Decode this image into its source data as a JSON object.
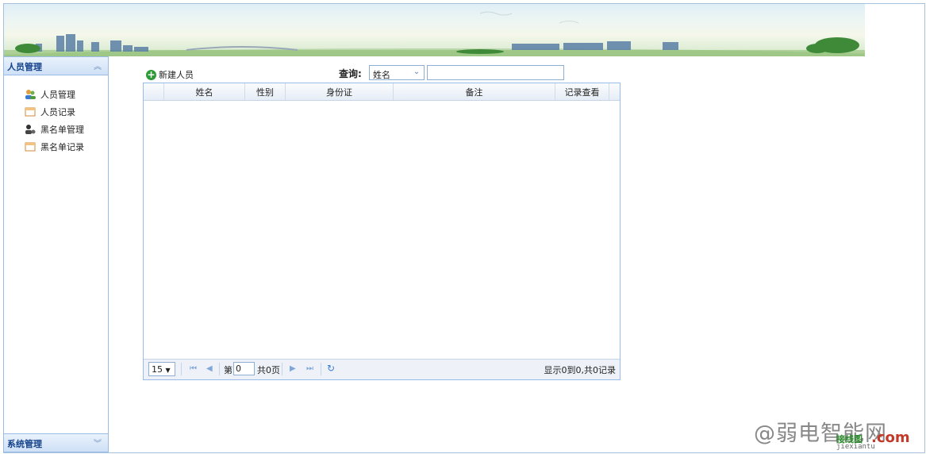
{
  "sidebar": {
    "top_panel_title": "人员管理",
    "items": [
      {
        "label": "人员管理",
        "icon": "users-icon"
      },
      {
        "label": "人员记录",
        "icon": "calendar-icon"
      },
      {
        "label": "黑名单管理",
        "icon": "blacklist-user-icon"
      },
      {
        "label": "黑名单记录",
        "icon": "calendar-icon"
      }
    ],
    "bottom_panel_title": "系统管理"
  },
  "toolbar": {
    "add_label": "新建人员",
    "query_label": "查询:",
    "field_select": "姓名",
    "search_value": ""
  },
  "grid": {
    "columns": [
      "姓名",
      "性别",
      "身份证",
      "备注",
      "记录查看"
    ],
    "rows": []
  },
  "pager": {
    "page_size": "15",
    "page_prefix": "第",
    "page_number": "0",
    "total_pages": "共0页",
    "summary": "显示0到0,共0记录"
  },
  "watermark": {
    "text": "@弱电智能网",
    "sub": "接线图",
    "com": ".com",
    "domain": "jiexiantu"
  },
  "colors": {
    "border": "#99bbe8",
    "header_text": "#15428b",
    "add_icon": "#2e9b36"
  }
}
